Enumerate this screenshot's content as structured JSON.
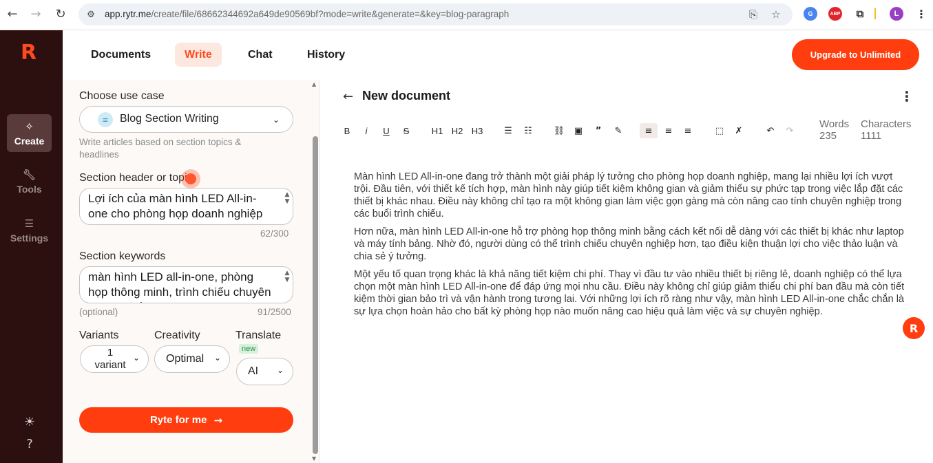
{
  "browser": {
    "url_main": "app.rytr.me",
    "url_rest": "/create/file/68662344692a649de90569bf?mode=write&generate=&key=blog-paragraph",
    "profile_initial": "L",
    "abp_label": "ABP"
  },
  "rail": {
    "logo": "R",
    "items": [
      {
        "label": "Create",
        "icon": "sparkle-icon"
      },
      {
        "label": "Tools",
        "icon": "wrench-icon"
      },
      {
        "label": "Settings",
        "icon": "sliders-icon"
      }
    ]
  },
  "nav": {
    "tabs": [
      "Documents",
      "Write",
      "Chat",
      "History"
    ],
    "upgrade_label": "Upgrade to Unlimited"
  },
  "panel": {
    "use_case_label": "Choose use case",
    "use_case_value": "Blog Section Writing",
    "use_case_help": "Write articles based on section topics & headlines",
    "section_header_label": "Section header or topic",
    "section_header_value": "Lợi ích của màn hình LED All-in-one cho phòng họp doanh nghiệp",
    "section_header_count": "62/300",
    "keywords_label": "Section keywords",
    "keywords_value": "màn hình LED all-in-one, phòng họp thông minh, trình chiếu chuyên nghiệp, tiết kiệm chi phí",
    "keywords_optional": "(optional)",
    "keywords_count": "91/2500",
    "variants_label": "Variants",
    "variants_value_1": "1",
    "variants_value_2": "variant",
    "creativity_label": "Creativity",
    "creativity_value": "Optimal",
    "translate_label": "Translate",
    "translate_badge": "new",
    "translate_value": "AI",
    "ryte_label": "Ryte for me"
  },
  "editor": {
    "title": "New document",
    "toolbar": {
      "bold": "B",
      "italic": "i",
      "underline": "U",
      "strike": "S",
      "h1": "H1",
      "h2": "H2",
      "h3": "H3"
    },
    "words_label": "Words",
    "words_value": "235",
    "chars_label": "Characters",
    "chars_value": "1111",
    "paragraphs": [
      "Màn hình LED All-in-one đang trở thành một giải pháp lý tưởng cho phòng họp doanh nghiệp, mang lại nhiều lợi ích vượt trội. Đầu tiên, với thiết kế tích hợp, màn hình này giúp tiết kiệm không gian và giảm thiểu sự phức tạp trong việc lắp đặt các thiết bị khác nhau. Điều này không chỉ tạo ra một không gian làm việc gọn gàng mà còn nâng cao tính chuyên nghiệp trong các buổi trình chiếu.",
      "Hơn nữa, màn hình LED All-in-one hỗ trợ phòng họp thông minh bằng cách kết nối dễ dàng với các thiết bị khác như laptop và máy tính bảng. Nhờ đó, người dùng có thể trình chiếu chuyên nghiệp hơn, tạo điều kiện thuận lợi cho việc thảo luận và chia sẻ ý tưởng.",
      "Một yếu tố quan trọng khác là khả năng tiết kiệm chi phí. Thay vì đầu tư vào nhiều thiết bị riêng lẻ, doanh nghiệp có thể lựa chọn một màn hình LED All-in-one để đáp ứng mọi nhu cầu. Điều này không chỉ giúp giảm thiểu chi phí ban đầu mà còn tiết kiệm thời gian bảo trì và vận hành trong tương lai. Với những lợi ích rõ ràng như vậy, màn hình LED All-in-one chắc chắn là sự lựa chọn hoàn hảo cho bất kỳ phòng họp nào muốn nâng cao hiệu quả làm việc và sự chuyên nghiệp."
    ]
  },
  "colors": {
    "accent": "#ff3d0f",
    "rail_bg": "#2c1010",
    "panel_bg": "#fcf9f6"
  }
}
